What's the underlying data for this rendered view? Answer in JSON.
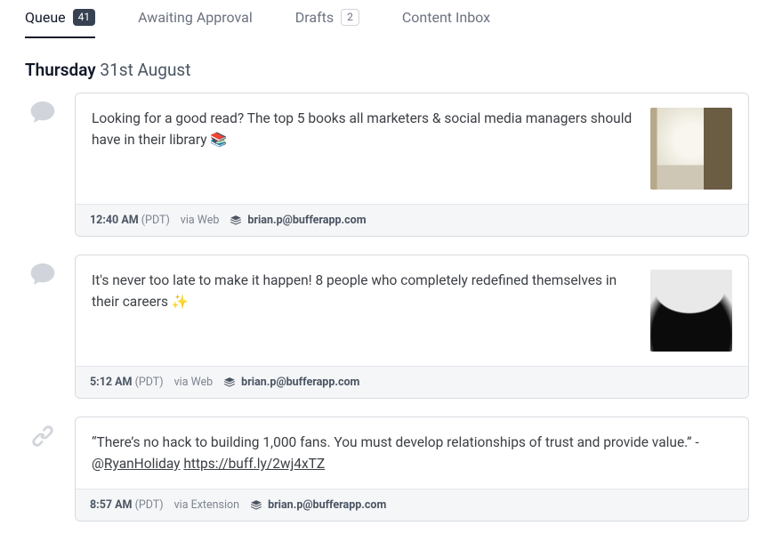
{
  "tabs": {
    "queue": {
      "label": "Queue",
      "count": "41"
    },
    "awaiting": {
      "label": "Awaiting Approval"
    },
    "drafts": {
      "label": "Drafts",
      "count": "2"
    },
    "inbox": {
      "label": "Content Inbox"
    }
  },
  "date": {
    "weekday": "Thursday",
    "rest": "31st August"
  },
  "posts": [
    {
      "type": "comment",
      "text": "Looking for a good read? The top 5 books all marketers & social media managers should have in their library 📚",
      "time_bold": "12:40 AM",
      "time_tz": "(PDT)",
      "via": "via Web",
      "user": "brian.p@bufferapp.com",
      "has_image": true,
      "thumb_class": "thumb-hall"
    },
    {
      "type": "comment",
      "text": "It's never too late to make it happen! 8 people who completely redefined themselves in their careers ✨",
      "time_bold": "5:12 AM",
      "time_tz": "(PDT)",
      "via": "via Web",
      "user": "brian.p@bufferapp.com",
      "has_image": true,
      "thumb_class": "thumb-portrait"
    },
    {
      "type": "link",
      "text_prefix": "“There’s no hack to building 1,000 fans.  You must develop relationships of trust and provide value.” - @",
      "text_underline1": "RyanHoliday",
      "text_mid": " ",
      "text_underline2": "https://buff.ly/2wj4xTZ",
      "time_bold": "8:57 AM",
      "time_tz": "(PDT)",
      "via": "via Extension",
      "user": "brian.p@bufferapp.com",
      "has_image": false
    }
  ]
}
